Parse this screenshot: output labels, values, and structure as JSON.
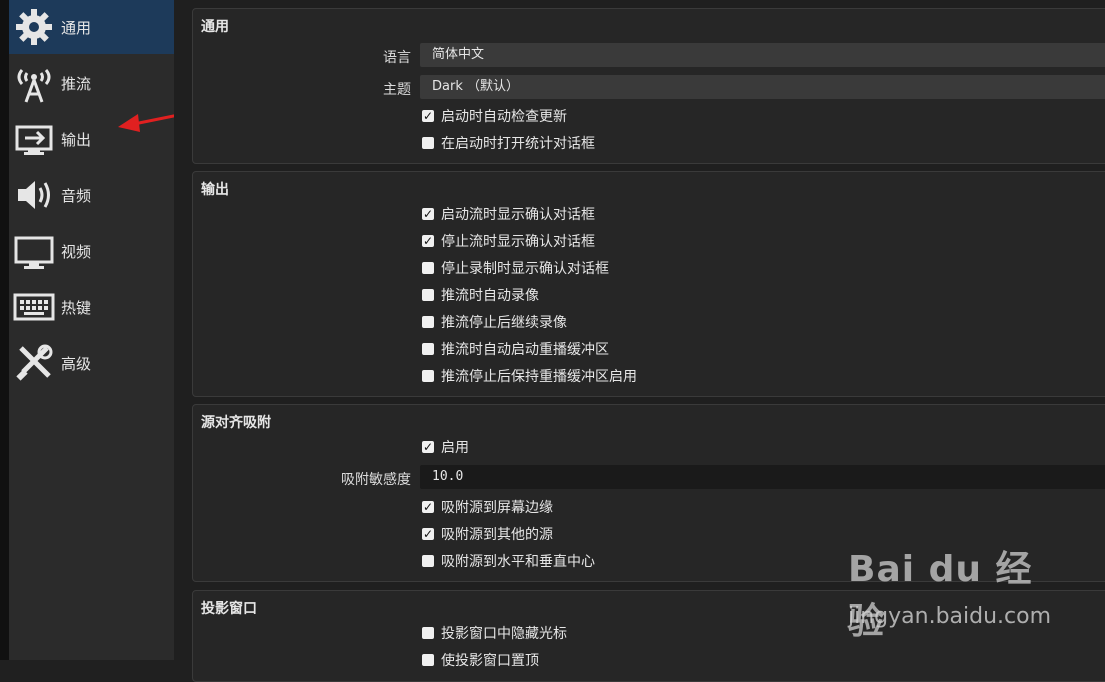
{
  "sidebar": {
    "items": [
      {
        "label": "通用",
        "icon": "gear-icon",
        "active": true
      },
      {
        "label": "推流",
        "icon": "broadcast-icon"
      },
      {
        "label": "输出",
        "icon": "output-icon"
      },
      {
        "label": "音频",
        "icon": "speaker-icon"
      },
      {
        "label": "视频",
        "icon": "monitor-icon"
      },
      {
        "label": "热键",
        "icon": "keyboard-icon"
      },
      {
        "label": "高级",
        "icon": "tools-icon"
      }
    ]
  },
  "general": {
    "title": "通用",
    "language_label": "语言",
    "language_value": "简体中文",
    "theme_label": "主题",
    "theme_value": "Dark （默认）",
    "checks": [
      {
        "label": "启动时自动检查更新",
        "checked": true
      },
      {
        "label": "在启动时打开统计对话框",
        "checked": false
      }
    ]
  },
  "output": {
    "title": "输出",
    "checks": [
      {
        "label": "启动流时显示确认对话框",
        "checked": true
      },
      {
        "label": "停止流时显示确认对话框",
        "checked": true
      },
      {
        "label": "停止录制时显示确认对话框",
        "checked": false
      },
      {
        "label": "推流时自动录像",
        "checked": false
      },
      {
        "label": "推流停止后继续录像",
        "checked": false
      },
      {
        "label": "推流时自动启动重播缓冲区",
        "checked": false
      },
      {
        "label": "推流停止后保持重播缓冲区启用",
        "checked": false
      }
    ]
  },
  "snapping": {
    "title": "源对齐吸附",
    "enable_label": "启用",
    "sensitivity_label": "吸附敏感度",
    "sensitivity_value": "10.0",
    "checks": [
      {
        "label": "吸附源到屏幕边缘",
        "checked": true
      },
      {
        "label": "吸附源到其他的源",
        "checked": true
      },
      {
        "label": "吸附源到水平和垂直中心",
        "checked": false
      }
    ]
  },
  "projector": {
    "title": "投影窗口",
    "checks": [
      {
        "label": "投影窗口中隐藏光标",
        "checked": false
      },
      {
        "label": "使投影窗口置顶",
        "checked": false
      }
    ]
  },
  "watermark": {
    "brand": "Bai du 经验",
    "url": "jingyan.baidu.com"
  },
  "colors": {
    "accent_active": "#1d3a5a",
    "annotation_arrow": "#e02020"
  }
}
